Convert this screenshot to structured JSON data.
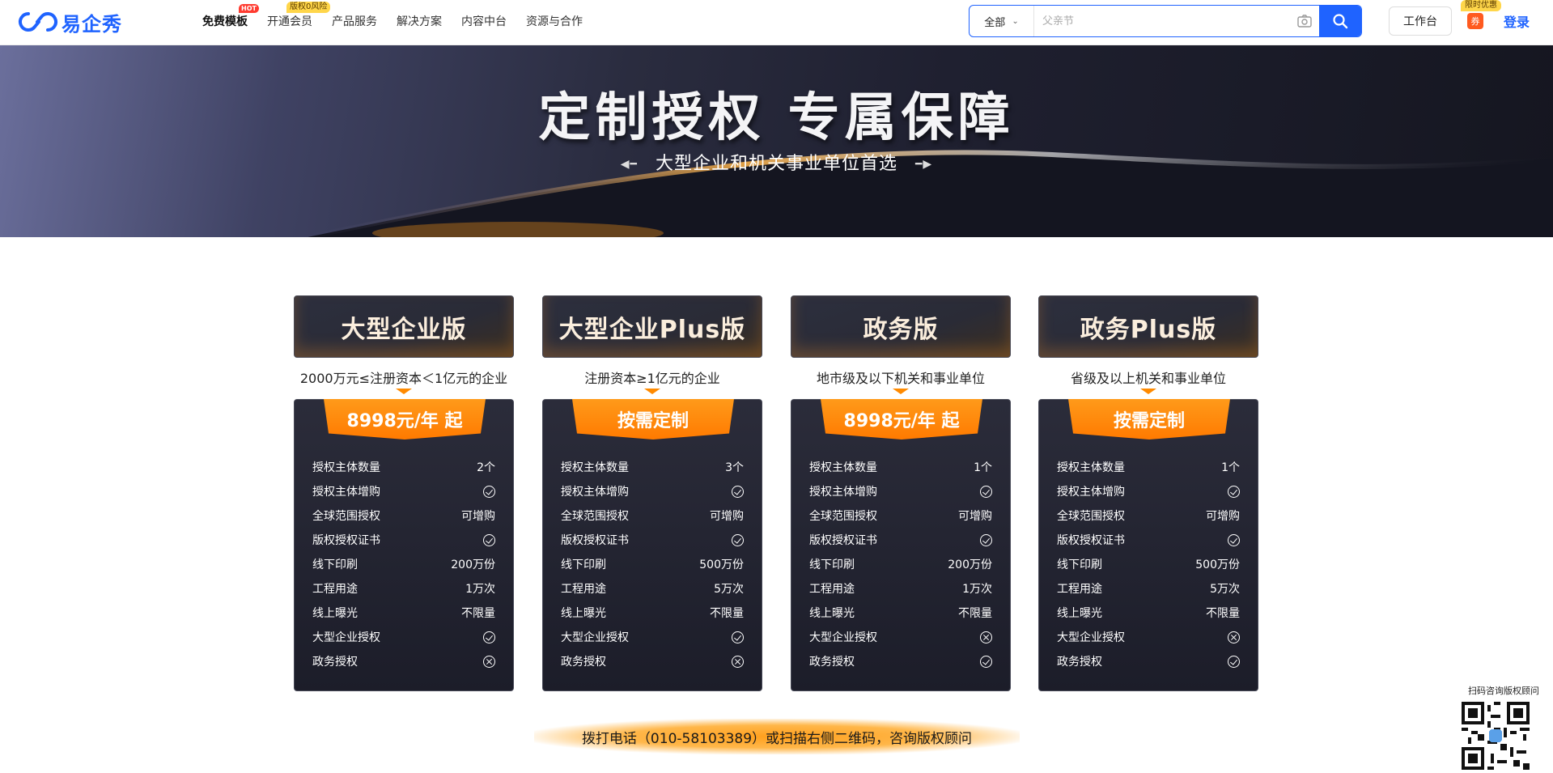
{
  "nav": {
    "logo_text": "易企秀",
    "menu": [
      {
        "label": "免费模板",
        "badge": "HOT"
      },
      {
        "label": "开通会员",
        "badge": "版权0风险"
      },
      {
        "label": "产品服务",
        "badge": ""
      },
      {
        "label": "解决方案",
        "badge": ""
      },
      {
        "label": "内容中台",
        "badge": ""
      },
      {
        "label": "资源与合作",
        "badge": ""
      }
    ],
    "search": {
      "category": "全部",
      "placeholder": "父亲节"
    },
    "workbench": "工作台",
    "coupon": "券",
    "limit_badge": "限时优惠",
    "login": "登录"
  },
  "banner": {
    "title": "定制授权 专属保障",
    "subtitle": "大型企业和机关事业单位首选"
  },
  "plans": [
    {
      "name": "大型企业版",
      "desc": "2000万元≤注册资本＜1亿元的企业",
      "price": "8998元/年 起",
      "features": [
        {
          "label": "授权主体数量",
          "value": "2个",
          "icon": ""
        },
        {
          "label": "授权主体增购",
          "value": "",
          "icon": "check-icon"
        },
        {
          "label": "全球范围授权",
          "value": "可增购",
          "icon": ""
        },
        {
          "label": "版权授权证书",
          "value": "",
          "icon": "check-icon"
        },
        {
          "label": "线下印刷",
          "value": "200万份",
          "icon": ""
        },
        {
          "label": "工程用途",
          "value": "1万次",
          "icon": ""
        },
        {
          "label": "线上曝光",
          "value": "不限量",
          "icon": ""
        },
        {
          "label": "大型企业授权",
          "value": "",
          "icon": "check-icon"
        },
        {
          "label": "政务授权",
          "value": "",
          "icon": "cross-icon"
        }
      ]
    },
    {
      "name": "大型企业Plus版",
      "desc": "注册资本≥1亿元的企业",
      "price": "按需定制",
      "features": [
        {
          "label": "授权主体数量",
          "value": "3个",
          "icon": ""
        },
        {
          "label": "授权主体增购",
          "value": "",
          "icon": "check-icon"
        },
        {
          "label": "全球范围授权",
          "value": "可增购",
          "icon": ""
        },
        {
          "label": "版权授权证书",
          "value": "",
          "icon": "check-icon"
        },
        {
          "label": "线下印刷",
          "value": "500万份",
          "icon": ""
        },
        {
          "label": "工程用途",
          "value": "5万次",
          "icon": ""
        },
        {
          "label": "线上曝光",
          "value": "不限量",
          "icon": ""
        },
        {
          "label": "大型企业授权",
          "value": "",
          "icon": "check-icon"
        },
        {
          "label": "政务授权",
          "value": "",
          "icon": "cross-icon"
        }
      ]
    },
    {
      "name": "政务版",
      "desc": "地市级及以下机关和事业单位",
      "price": "8998元/年 起",
      "features": [
        {
          "label": "授权主体数量",
          "value": "1个",
          "icon": ""
        },
        {
          "label": "授权主体增购",
          "value": "",
          "icon": "check-icon"
        },
        {
          "label": "全球范围授权",
          "value": "可增购",
          "icon": ""
        },
        {
          "label": "版权授权证书",
          "value": "",
          "icon": "check-icon"
        },
        {
          "label": "线下印刷",
          "value": "200万份",
          "icon": ""
        },
        {
          "label": "工程用途",
          "value": "1万次",
          "icon": ""
        },
        {
          "label": "线上曝光",
          "value": "不限量",
          "icon": ""
        },
        {
          "label": "大型企业授权",
          "value": "",
          "icon": "cross-icon"
        },
        {
          "label": "政务授权",
          "value": "",
          "icon": "check-icon"
        }
      ]
    },
    {
      "name": "政务Plus版",
      "desc": "省级及以上机关和事业单位",
      "price": "按需定制",
      "features": [
        {
          "label": "授权主体数量",
          "value": "1个",
          "icon": ""
        },
        {
          "label": "授权主体增购",
          "value": "",
          "icon": "check-icon"
        },
        {
          "label": "全球范围授权",
          "value": "可增购",
          "icon": ""
        },
        {
          "label": "版权授权证书",
          "value": "",
          "icon": "check-icon"
        },
        {
          "label": "线下印刷",
          "value": "500万份",
          "icon": ""
        },
        {
          "label": "工程用途",
          "value": "5万次",
          "icon": ""
        },
        {
          "label": "线上曝光",
          "value": "不限量",
          "icon": ""
        },
        {
          "label": "大型企业授权",
          "value": "",
          "icon": "cross-icon"
        },
        {
          "label": "政务授权",
          "value": "",
          "icon": "check-icon"
        }
      ]
    }
  ],
  "contact": "拨打电话（010-58103389）或扫描右侧二维码，咨询版权顾问",
  "qr": {
    "label": "扫码咨询版权顾问"
  },
  "colors": {
    "brand": "#1f63ff",
    "accent": "#ff8a00"
  }
}
